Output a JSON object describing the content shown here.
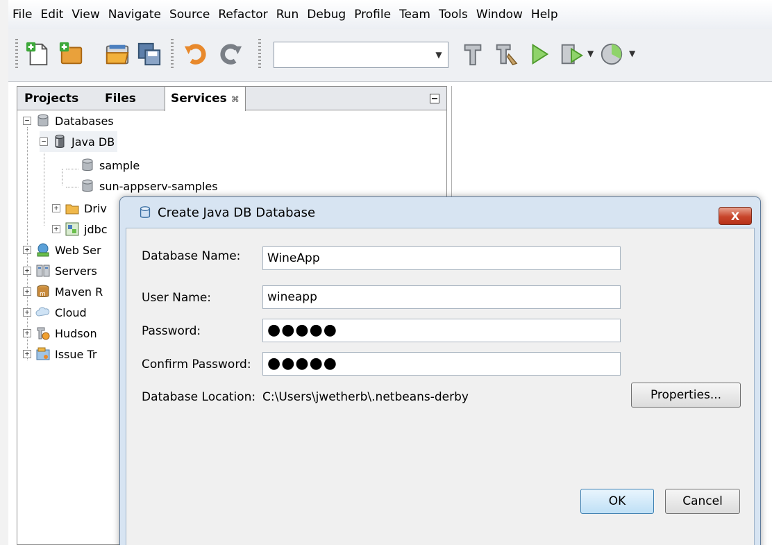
{
  "menu": [
    "File",
    "Edit",
    "View",
    "Navigate",
    "Source",
    "Refactor",
    "Run",
    "Debug",
    "Profile",
    "Team",
    "Tools",
    "Window",
    "Help"
  ],
  "toolbar": {
    "config_value": "",
    "icons": [
      "new-file-icon",
      "new-project-icon",
      "open-project-icon",
      "save-all-icon",
      "undo-icon",
      "redo-icon",
      "build-icon",
      "clean-build-icon",
      "run-icon",
      "debug-icon",
      "profile-icon"
    ]
  },
  "panel": {
    "tabs": [
      "Projects",
      "Files",
      "Services"
    ],
    "tab_close": "⌘",
    "tree": [
      {
        "label": "Databases",
        "toggle": "−"
      },
      {
        "label": "Java DB",
        "toggle": "−"
      },
      {
        "label": "sample"
      },
      {
        "label": "sun-appserv-samples"
      },
      {
        "label": "Driv",
        "toggle": "+"
      },
      {
        "label": "jdbc",
        "toggle": "+"
      },
      {
        "label": "Web Ser",
        "toggle": "+"
      },
      {
        "label": "Servers",
        "toggle": "+"
      },
      {
        "label": "Maven R",
        "toggle": "+"
      },
      {
        "label": "Cloud",
        "toggle": "+"
      },
      {
        "label": "Hudson",
        "toggle": "+"
      },
      {
        "label": "Issue Tr",
        "toggle": "+"
      }
    ]
  },
  "dialog": {
    "title": "Create Java DB Database",
    "close_label": "X",
    "db_name_label": "Database Name:",
    "db_name_value": "WineApp",
    "user_label": "User Name:",
    "user_value": "wineapp",
    "password_label": "Password:",
    "password_value": "●●●●●",
    "confirm_label": "Confirm Password:",
    "confirm_value": "●●●●●",
    "location_label": "Database Location:",
    "location_value": "C:\\Users\\jwetherb\\.netbeans-derby",
    "properties_button": "Properties...",
    "ok_button": "OK",
    "cancel_button": "Cancel"
  }
}
